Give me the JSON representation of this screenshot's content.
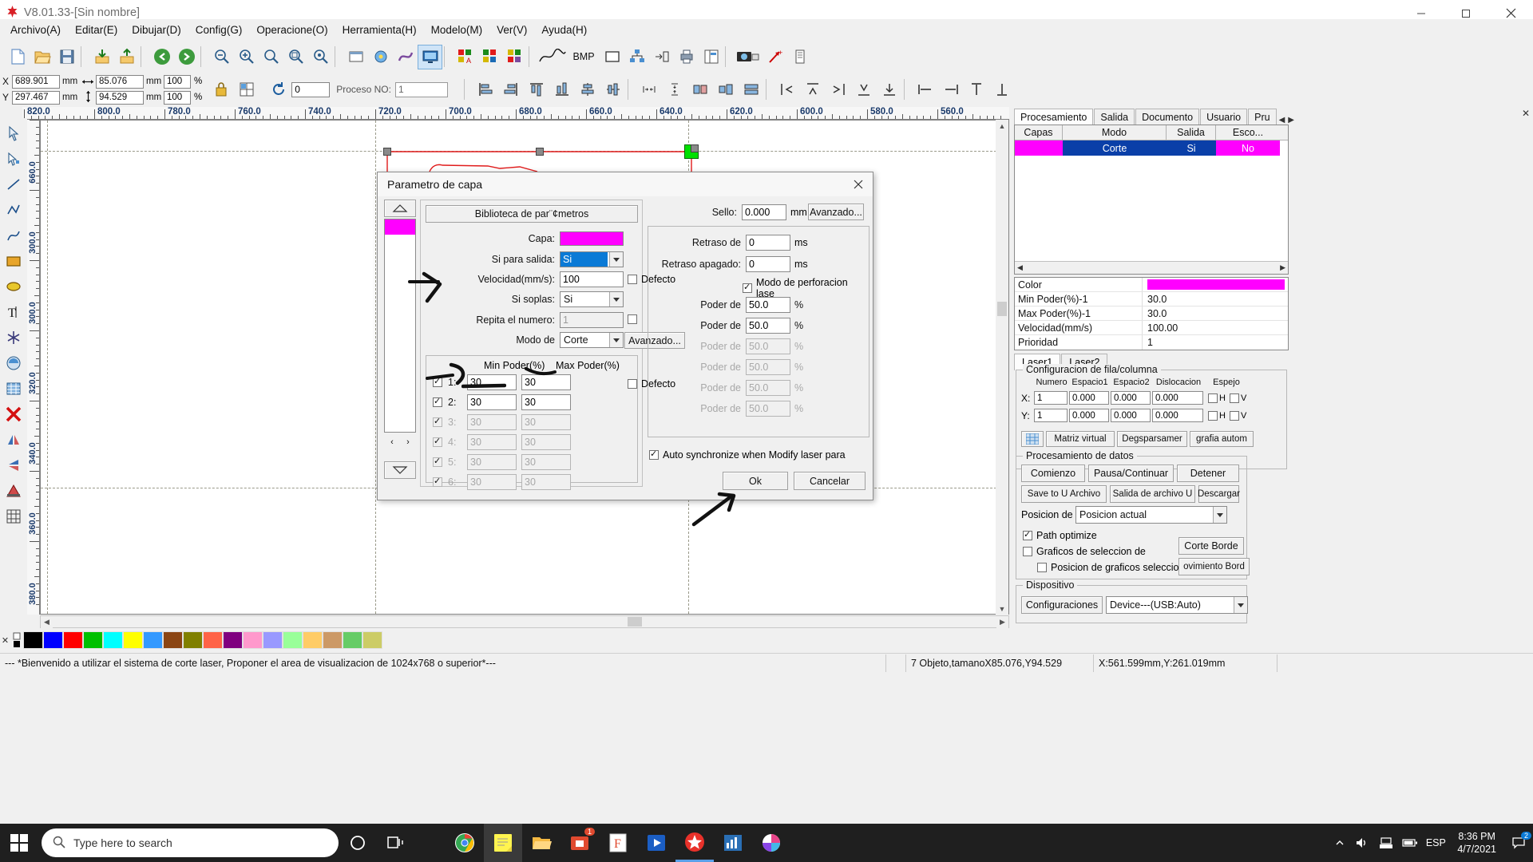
{
  "window": {
    "title": "V8.01.33-[Sin nombre]",
    "logo_icon": "rdworks-logo-icon",
    "minimize_icon": "minimize-icon",
    "maximize_icon": "maximize-icon",
    "close_icon": "close-icon"
  },
  "menu": [
    {
      "label": "Archivo(A)"
    },
    {
      "label": "Editar(E)"
    },
    {
      "label": "Dibujar(D)"
    },
    {
      "label": "Config(G)"
    },
    {
      "label": "Operacione(O)"
    },
    {
      "label": "Herramienta(H)"
    },
    {
      "label": "Modelo(M)"
    },
    {
      "label": "Ver(V)"
    },
    {
      "label": "Ayuda(H)"
    }
  ],
  "toolbar": {
    "items": [
      "new-file-icon",
      "open-file-icon",
      "save-file-icon",
      "sep",
      "import-icon",
      "export-icon",
      "sep",
      "undo-icon",
      "redo-icon",
      "sep",
      "zoom-out-icon",
      "zoom-in-icon",
      "zoom-fit-icon",
      "zoom-selection-icon",
      "zoom-all-icon",
      "sep",
      "frame-icon",
      "circle-tool-icon",
      "curve-tool-icon",
      "display-icon",
      "sep",
      "layer-red-icon",
      "layer-green-icon",
      "layer-multi-icon",
      "sep",
      "curve-smooth-icon",
      "bmp-icon",
      "rect-icon",
      "node-icon",
      "offset-icon",
      "print-icon",
      "page-icon",
      "sep",
      "camera-icon",
      "arrow-up-icon",
      "list-icon"
    ],
    "bmp_label": "BMP"
  },
  "coordbar": {
    "x_label": "X",
    "y_label": "Y",
    "x_value": "689.901",
    "y_value": "297.467",
    "x_unit": "mm",
    "y_unit": "mm",
    "width_icon": "width-arrow-icon",
    "height_icon": "height-arrow-icon",
    "width_value": "85.076",
    "height_value": "94.529",
    "w_unit": "mm",
    "h_unit": "mm",
    "scale_w": "100",
    "scale_h": "100",
    "pct": "%",
    "lock_icon": "lock-icon",
    "grid_icon": "grid-icon",
    "rotate_icon": "rotate-icon",
    "angle_value": "0",
    "process_label": "Proceso NO:",
    "process_value": "1",
    "align_icons": [
      "align-left-icon",
      "align-right-icon",
      "align-top-icon",
      "align-bottom-icon",
      "align-center-h-icon",
      "align-center-v-icon",
      "dist-h-icon",
      "dist-v-icon",
      "size-same-icon",
      "size-h-icon",
      "size-v-icon",
      "arrange-left-icon",
      "arrange-up-icon",
      "arrange-right-icon",
      "arrange-down-icon",
      "arrange-center-icon",
      "snap-left-icon",
      "snap-right-icon",
      "snap-top-icon",
      "snap-bottom-icon"
    ]
  },
  "ruler": {
    "h_labels": [
      "820.0",
      "800.0",
      "780.0",
      "760.0",
      "740.0",
      "720.0",
      "700.0",
      "680.0",
      "660.0",
      "640.0",
      "620.0",
      "600.0",
      "580.0",
      "560.0"
    ],
    "v_labels": [
      "660.0",
      "300.0",
      "300.0",
      "320.0",
      "340.0",
      "360.0",
      "380.0"
    ]
  },
  "left_tools": [
    "select-arrow-icon",
    "node-edit-icon",
    "line-tool-icon",
    "polyline-tool-icon",
    "bezier-tool-icon",
    "rectangle-tool-icon",
    "ellipse-tool-icon",
    "text-tool-icon",
    "star-tool-icon",
    "capture-icon",
    "grid-array-icon",
    "delete-x-icon",
    "mirror-h-icon",
    "mirror-v-icon",
    "measure-icon",
    "matrix-icon"
  ],
  "right_panel": {
    "close_icon": "close-icon",
    "tabs": [
      {
        "label": "Procesamiento",
        "active": true
      },
      {
        "label": "Salida",
        "active": false
      },
      {
        "label": "Documento",
        "active": false
      },
      {
        "label": "Usuario",
        "active": false
      },
      {
        "label": "Pru",
        "active": false
      }
    ],
    "tab_prev_icon": "tab-prev-icon",
    "tab_next_icon": "tab-next-icon",
    "layer_table": {
      "headers": [
        "Capas",
        "Modo",
        "Salida",
        "Esco..."
      ],
      "rows": [
        {
          "color": "#ff00ff",
          "modo": "Corte",
          "salida": "Si",
          "escolar": "No"
        }
      ],
      "scroll_left_icon": "scroll-left-icon",
      "scroll_right_icon": "scroll-right-icon"
    },
    "properties": [
      {
        "key": "Color",
        "value": "",
        "swatch": "#ff00ff"
      },
      {
        "key": "Min Poder(%)-1",
        "value": "30.0"
      },
      {
        "key": "Max Poder(%)-1",
        "value": "30.0"
      },
      {
        "key": "Velocidad(mm/s)",
        "value": "100.00"
      },
      {
        "key": "Prioridad",
        "value": "1"
      }
    ],
    "laser_tabs": [
      {
        "label": "Laser1",
        "active": true
      },
      {
        "label": "Laser2",
        "active": false
      }
    ],
    "row_col_group": {
      "title": "Configuracion de fila/columna",
      "headers": [
        "Numero",
        "Espacio1",
        "Espacio2",
        "Dislocacion",
        "Espejo"
      ],
      "rows": [
        {
          "axis": "X:",
          "numero": "1",
          "espacio1": "0.000",
          "espacio2": "0.000",
          "dislocacion": "0.000",
          "h": "H",
          "v": "V"
        },
        {
          "axis": "Y:",
          "numero": "1",
          "espacio1": "0.000",
          "espacio2": "0.000",
          "dislocacion": "0.000",
          "h": "H",
          "v": "V"
        }
      ],
      "buttons": [
        "Matriz virtual",
        "Degsparsamer",
        "grafia autom"
      ],
      "matrix_icon": "matrix-icon"
    },
    "data_group": {
      "title": "Procesamiento de datos",
      "buttons_row1": [
        "Comienzo",
        "Pausa/Continuar",
        "Detener"
      ],
      "buttons_row2": [
        "Save to U Archivo",
        "Salida de archivo U",
        "Descargar"
      ],
      "position_label": "Posicion de",
      "position_value": "Posicion actual",
      "path_optimize": {
        "label": "Path optimize",
        "checked": true
      },
      "select_graphics": {
        "label": "Graficos de seleccion de",
        "checked": false
      },
      "selected_position": {
        "label": "Posicion de graficos seleccionado",
        "checked": false
      },
      "corte_borde": "Corte Borde",
      "movimiento_borde": "ovimiento Bord"
    },
    "device_group": {
      "title": "Dispositivo",
      "config_button": "Configuraciones",
      "device_value": "Device---(USB:Auto)"
    }
  },
  "dialog": {
    "title": "Parametro de capa",
    "close_icon": "close-icon",
    "layer_up_icon": "layer-up-icon",
    "layer_down_icon": "layer-down-icon",
    "layer_prev_icon": "layer-prev-icon",
    "layer_next_icon": "layer-next-icon",
    "layer_colors": [
      "#ff00ff"
    ],
    "library_button": "Biblioteca de par¨¢metros",
    "left_fields": [
      {
        "label": "Capa:",
        "type": "color",
        "value": "#ff00ff"
      },
      {
        "label": "Si para salida:",
        "type": "select",
        "value": "Si",
        "selected": true
      },
      {
        "label": "Velocidad(mm/s):",
        "type": "text",
        "value": "100",
        "check": "Defecto",
        "checked": false
      },
      {
        "label": "Si soplas:",
        "type": "select",
        "value": "Si"
      },
      {
        "label": "Repita el numero:",
        "type": "text",
        "value": "1",
        "disabled": true,
        "check": "",
        "checked": false
      },
      {
        "label": "Modo de",
        "type": "select",
        "value": "Corte",
        "button": "Avanzado..."
      }
    ],
    "power_table": {
      "col_min": "Min Poder(%)",
      "col_max": "Max Poder(%)",
      "defecto_label": "Defecto",
      "defecto_checked": false,
      "rows": [
        {
          "index": "1:",
          "checked": true,
          "min": "30",
          "max": "30",
          "disabled": false
        },
        {
          "index": "2:",
          "checked": true,
          "min": "30",
          "max": "30",
          "disabled": false
        },
        {
          "index": "3:",
          "checked": true,
          "min": "30",
          "max": "30",
          "disabled": true
        },
        {
          "index": "4:",
          "checked": true,
          "min": "30",
          "max": "30",
          "disabled": true
        },
        {
          "index": "5:",
          "checked": true,
          "min": "30",
          "max": "30",
          "disabled": true
        },
        {
          "index": "6:",
          "checked": true,
          "min": "30",
          "max": "30",
          "disabled": true
        }
      ]
    },
    "right_fields": {
      "sello_label": "Sello:",
      "sello_value": "0.000",
      "sello_unit": "mm",
      "avanzado_button": "Avanzado...",
      "retraso_de_label": "Retraso de",
      "retraso_de_value": "0",
      "retraso_de_unit": "ms",
      "retraso_apagado_label": "Retraso apagado:",
      "retraso_apagado_value": "0",
      "retraso_apagado_unit": "ms",
      "perf_mode_label": "Modo de perforacion lase",
      "perf_mode_checked": true,
      "poder_rows": [
        {
          "label": "Poder de",
          "value": "50.0",
          "unit": "%",
          "disabled": false
        },
        {
          "label": "Poder de",
          "value": "50.0",
          "unit": "%",
          "disabled": false
        },
        {
          "label": "Poder de",
          "value": "50.0",
          "unit": "%",
          "disabled": true
        },
        {
          "label": "Poder de",
          "value": "50.0",
          "unit": "%",
          "disabled": true
        },
        {
          "label": "Poder de",
          "value": "50.0",
          "unit": "%",
          "disabled": true
        },
        {
          "label": "Poder de",
          "value": "50.0",
          "unit": "%",
          "disabled": true
        }
      ]
    },
    "auto_sync": {
      "label": "Auto synchronize when Modify laser para",
      "checked": true
    },
    "ok_button": "Ok",
    "cancel_button": "Cancelar"
  },
  "statusbar": {
    "message": "--- *Bienvenido a utilizar el sistema de corte laser, Proponer el area de visualizacion de 1024x768 o superior*---",
    "object_info": "7 Objeto,tamanoX85.076,Y94.529",
    "coords": "X:561.599mm,Y:261.019mm"
  },
  "taskbar": {
    "start_icon": "windows-start-icon",
    "search_icon": "search-icon",
    "search_placeholder": "Type here to search",
    "cortana_icon": "cortana-circle-icon",
    "taskview_icon": "task-view-icon",
    "apps": [
      "chrome-icon",
      "sticky-notes-icon",
      "file-explorer-icon",
      "store-icon",
      "app-f-icon",
      "media-player-icon",
      "rdworks-icon",
      "chart-app-icon",
      "paint-3d-icon"
    ],
    "store_badge": "1",
    "tray_up_icon": "tray-chevron-icon",
    "volume_icon": "volume-icon",
    "network_icon": "network-icon",
    "battery_icon": "battery-icon",
    "language": "ESP",
    "time": "8:36 PM",
    "date": "4/7/2021",
    "notification_icon": "notification-icon",
    "notification_count": "2"
  },
  "colors": {
    "accent": "#ff00ff",
    "selection_blue": "#0a7ad6",
    "canvas_red": "#e01b1b",
    "taskbar": "#1f1f1f"
  },
  "palette_colors": [
    "#000000",
    "#0000ff",
    "#ff0000",
    "#00c000",
    "#00ffff",
    "#ffff00",
    "#3399ff",
    "#8b4513",
    "#808000",
    "#ff6347",
    "#800080",
    "#ff99cc",
    "#9999ff",
    "#99ff99",
    "#ffcc66",
    "#cc9966",
    "#66cc66",
    "#cccc66"
  ]
}
